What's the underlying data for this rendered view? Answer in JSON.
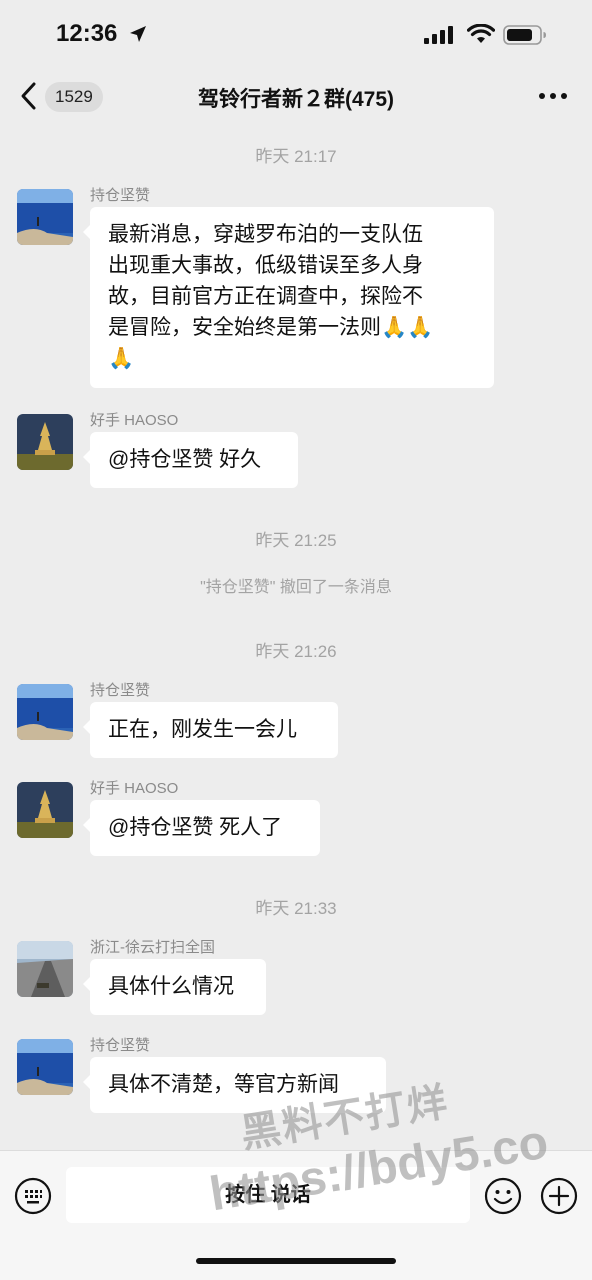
{
  "status": {
    "time": "12:36"
  },
  "nav": {
    "back_badge": "1529",
    "title": "驾铃行者新２群(475)"
  },
  "timestamps": {
    "t1": "昨天 21:17",
    "t2": "昨天 21:25",
    "t3": "昨天 21:26",
    "t4": "昨天 21:33"
  },
  "system_notes": {
    "recall": "\"持仓坚赞\" 撤回了一条消息"
  },
  "messages": [
    {
      "sender": "持仓坚赞",
      "lines": [
        "最新消息，穿越罗布泊的一支队伍",
        "出现重大事故，低级错误至多人身",
        "故，目前官方正在调查中，探险不",
        "是冒险，安全始终是第一法则"
      ],
      "emoji": "🙏🙏",
      "emoji2": "🙏"
    },
    {
      "sender": "好手 HAOSO",
      "text": "@持仓坚赞 好久"
    },
    {
      "sender": "持仓坚赞",
      "text": "正在，刚发生一会儿"
    },
    {
      "sender": "好手 HAOSO",
      "text": "@持仓坚赞 死人了"
    },
    {
      "sender": "浙江-徐云打扫全国",
      "text": "具体什么情况"
    },
    {
      "sender": "持仓坚赞",
      "text": "具体不清楚，等官方新闻"
    }
  ],
  "input": {
    "voice_label": "按住 说话"
  },
  "watermark": {
    "line1": "黑料不打烊",
    "line2": "https://bdy5.co"
  },
  "colors": {
    "background": "#ededed",
    "bubble": "#ffffff",
    "meta_text": "#a3a3a3"
  }
}
